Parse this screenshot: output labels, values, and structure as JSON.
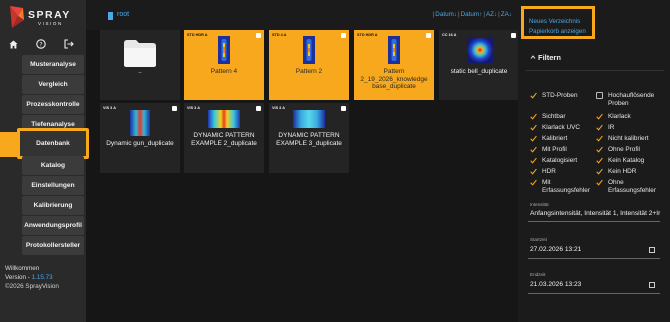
{
  "brand": {
    "name": "SPRAY",
    "sub": "VISION",
    "accent": "#f7a81c",
    "link": "#4aa8e8"
  },
  "topicons": [
    "home-icon",
    "help-icon",
    "logout-icon"
  ],
  "sidebar": {
    "items": [
      {
        "label": "Musteranalyse"
      },
      {
        "label": "Vergleich"
      },
      {
        "label": "Prozesskontrolle"
      },
      {
        "label": "Tiefenanalyse"
      },
      {
        "label": "Datenbank"
      },
      {
        "label": "Katalog"
      },
      {
        "label": "Einstellungen"
      },
      {
        "label": "Kalibrierung"
      },
      {
        "label": "Anwendungsprofil"
      },
      {
        "label": "Protokollersteller"
      }
    ],
    "footer": {
      "welcome": "Willkommen",
      "version_label": "Version - ",
      "version": "1.15.73",
      "copyright": "©2026 SprayVision"
    }
  },
  "path": {
    "root": "root",
    "sort": [
      "Datum↓",
      "Datum↑",
      "AZ↓",
      "ZA↓"
    ]
  },
  "tiles": [
    {
      "label": "..",
      "type": "folder"
    },
    {
      "label": "Pattern 4",
      "tag": "STD HDR A"
    },
    {
      "label": "Pattern 2",
      "tag": "STD 4 A"
    },
    {
      "label": "Pattern 2_19_2026_knowledge base_duplicate",
      "tag": "STD HDR A"
    },
    {
      "label": "static bell_duplicate",
      "tag": "CC 16 A"
    },
    {
      "label": "Dynamic gun_duplicate",
      "tag": "VIS 3 A"
    },
    {
      "label": "DYNAMIC PATTERN EXAMPLE 2_duplicate",
      "tag": "VIS 3 A"
    },
    {
      "label": "DYNAMIC PATTERN EXAMPLE 3_duplicate",
      "tag": "VIS 3 A"
    }
  ],
  "actions": {
    "new_folder": "Neues Verzeichnis",
    "trash": "Papierkorb anzeigen"
  },
  "filter": {
    "title": "Filtern",
    "left": [
      {
        "label": "STD-Proben",
        "checked": true
      },
      {
        "label": "Sichtbar",
        "checked": true
      },
      {
        "label": "Klarlack UVC",
        "checked": true
      },
      {
        "label": "Kalibriert",
        "checked": true
      },
      {
        "label": "Mit Profil",
        "checked": true
      },
      {
        "label": "Katalogisiert",
        "checked": true
      },
      {
        "label": "HDR",
        "checked": true
      },
      {
        "label": "Mit Erfassungsfehler",
        "checked": true
      }
    ],
    "right": [
      {
        "label": "Hochauflösende Proben",
        "checked": false
      },
      {
        "label": "Klarlack",
        "checked": true
      },
      {
        "label": "IR",
        "checked": true
      },
      {
        "label": "Nicht kalibriert",
        "checked": true
      },
      {
        "label": "Ohne Profil",
        "checked": true
      },
      {
        "label": "Kein Katalog",
        "checked": true
      },
      {
        "label": "Kein HDR",
        "checked": true
      },
      {
        "label": "Ohne Erfassungsfehler",
        "checked": true
      }
    ],
    "intensity_label": "Intensität",
    "intensity_value": "Anfangsintensität, Intensität 1, Intensität 2+Ir",
    "start_label": "Startzeit",
    "start_value": "27.02.2026 13:21",
    "end_label": "Endzeit",
    "end_value": "21.03.2026 13:23"
  }
}
